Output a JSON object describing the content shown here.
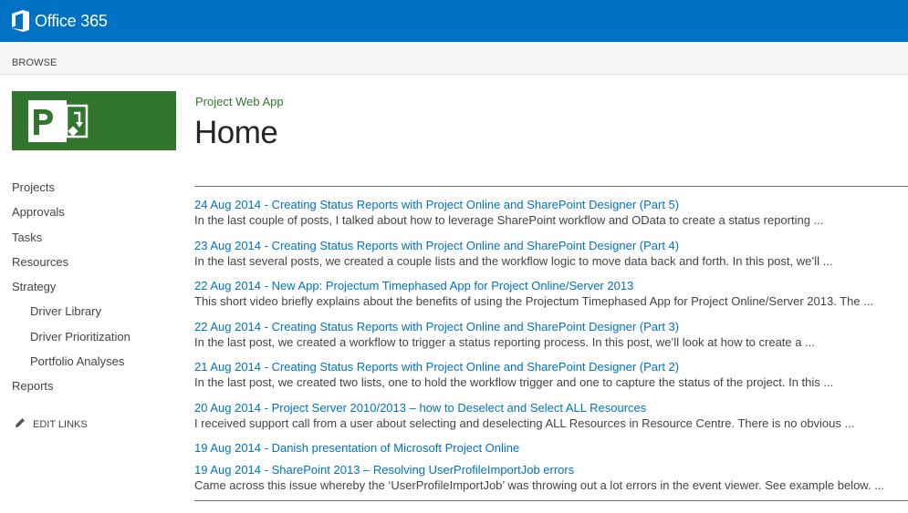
{
  "suite_bar": {
    "brand": "Office 365",
    "color": "#0072c6"
  },
  "ribbon": {
    "browse_tab": "BROWSE"
  },
  "site": {
    "logo_icon": "project-logo-icon",
    "logo_color": "#31752f",
    "site_title": "Project Web App",
    "page_title": "Home"
  },
  "quick_launch": {
    "items": [
      {
        "label": "Projects",
        "level": 0
      },
      {
        "label": "Approvals",
        "level": 0
      },
      {
        "label": "Tasks",
        "level": 0
      },
      {
        "label": "Resources",
        "level": 0
      },
      {
        "label": "Strategy",
        "level": 0
      },
      {
        "label": "Driver Library",
        "level": 1
      },
      {
        "label": "Driver Prioritization",
        "level": 1
      },
      {
        "label": "Portfolio Analyses",
        "level": 1
      },
      {
        "label": "Reports",
        "level": 0
      }
    ],
    "edit_links": "EDIT LINKS"
  },
  "feed": {
    "items": [
      {
        "title": "24 Aug 2014 - Creating Status Reports with Project Online and SharePoint Designer (Part 5)",
        "excerpt": "In the last couple of posts, I talked about how to leverage SharePoint workflow and OData to create a status reporting ..."
      },
      {
        "title": "23 Aug 2014 - Creating Status Reports with Project Online and SharePoint Designer (Part 4)",
        "excerpt": "In the last several posts, we created a couple lists and the workflow logic to move data back and forth.  In this post, we’ll ..."
      },
      {
        "title": "22 Aug 2014 - New App: Projectum Timephased App for Project Online/Server 2013",
        "excerpt": "This short video briefly explains about the benefits of using the Projectum Timephased App for Project Online/Server 2013. The ..."
      },
      {
        "title": "22 Aug 2014 - Creating Status Reports with Project Online and SharePoint Designer (Part 3)",
        "excerpt": "In the last post, we created a workflow to trigger a status reporting process.  In this post, we’ll look at how to create a ..."
      },
      {
        "title": "21 Aug 2014 - Creating Status Reports with Project Online and SharePoint Designer (Part 2)",
        "excerpt": "In the last post, we created two lists, one to hold the workflow trigger and one to capture the status of the project.  In this ..."
      },
      {
        "title": "20 Aug 2014 - Project Server 2010/2013 – how to Deselect and Select ALL Resources",
        "excerpt": "I received support call from a user about selecting and deselecting ALL Resources in Resource Centre. There is no obvious ..."
      },
      {
        "title": "19 Aug 2014 - Danish presentation of Microsoft Project Online",
        "excerpt": ""
      },
      {
        "title": "19 Aug 2014 - SharePoint 2013 – Resolving UserProfileImportJob errors",
        "excerpt": "Came across this issue whereby the ‘UserProfileImportJob’ was throwing out a lot errors in the event viewer. See example below. ..."
      }
    ]
  }
}
